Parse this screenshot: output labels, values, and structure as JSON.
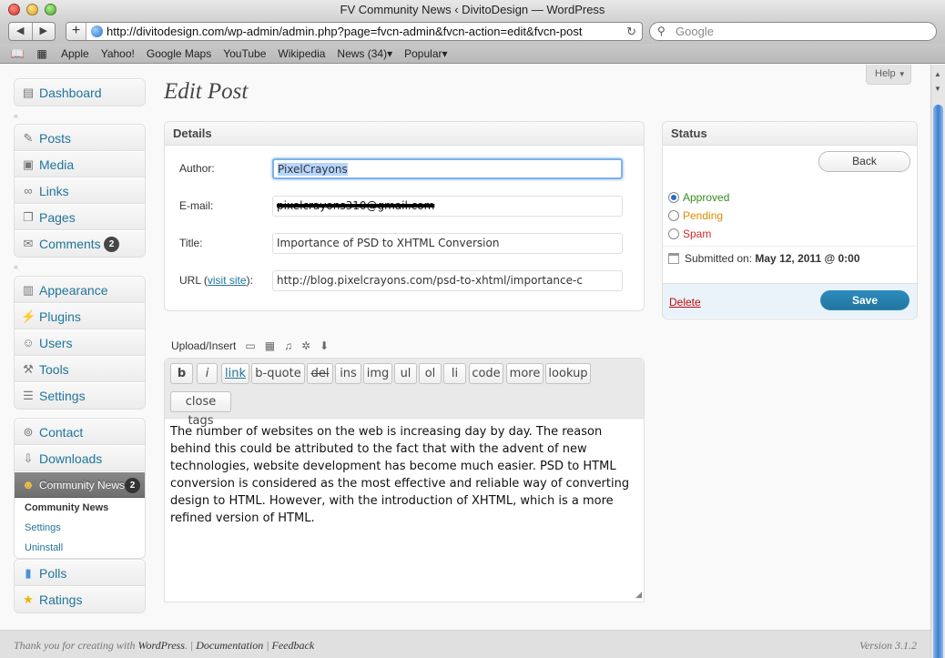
{
  "browser": {
    "window_title": "FV Community News ‹ DivitoDesign — WordPress",
    "url": "http://divitodesign.com/wp-admin/admin.php?page=fvcn-admin&fvcn-action=edit&fvcn-post",
    "search_placeholder": "Google",
    "back": "◀",
    "forward": "▶",
    "add": "+",
    "reload": "↻",
    "bookmarks": [
      "Apple",
      "Yahoo!",
      "Google Maps",
      "YouTube",
      "Wikipedia",
      "News (34)▾",
      "Popular▾"
    ]
  },
  "menu": {
    "dashboard": "Dashboard",
    "group1": [
      {
        "label": "Posts",
        "icon": "pin-icon"
      },
      {
        "label": "Media",
        "icon": "media-icon"
      },
      {
        "label": "Links",
        "icon": "link-icon"
      },
      {
        "label": "Pages",
        "icon": "pages-icon"
      },
      {
        "label": "Comments",
        "icon": "comments-icon",
        "badge": "2"
      }
    ],
    "group2": [
      {
        "label": "Appearance",
        "icon": "appearance-icon"
      },
      {
        "label": "Plugins",
        "icon": "plugins-icon"
      },
      {
        "label": "Users",
        "icon": "users-icon"
      },
      {
        "label": "Tools",
        "icon": "tools-icon"
      },
      {
        "label": "Settings",
        "icon": "settings-icon"
      }
    ],
    "group3": [
      {
        "label": "Contact",
        "icon": "contact-icon"
      },
      {
        "label": "Downloads",
        "icon": "downloads-icon"
      }
    ],
    "community": {
      "label": "Community News",
      "badge": "2"
    },
    "submenu": [
      "Community News",
      "Settings",
      "Uninstall"
    ],
    "group4": [
      {
        "label": "Polls",
        "icon": "polls-icon"
      },
      {
        "label": "Ratings",
        "icon": "star-icon"
      }
    ]
  },
  "header": {
    "help": "Help",
    "title": "Edit Post"
  },
  "details": {
    "heading": "Details",
    "author_label": "Author:",
    "author_value": "PixelCrayons",
    "email_label": "E-mail:",
    "email_value": "pixelcrayons310@gmail.com",
    "title_label": "Title:",
    "title_value": "Importance of PSD to XHTML Conversion",
    "url_label_prefix": "URL (",
    "url_label_link": "visit site",
    "url_label_suffix": "):",
    "url_value": "http://blog.pixelcrayons.com/psd-to-xhtml/importance-c"
  },
  "status": {
    "heading": "Status",
    "back": "Back",
    "approved": "Approved",
    "pending": "Pending",
    "spam": "Spam",
    "approved_color": "#3a8a1e",
    "pending_color": "#e08a00",
    "spam_color": "#d22c2c",
    "submitted_label": "Submitted on:",
    "submitted_value": "May 12, 2011 @ 0:00",
    "delete": "Delete",
    "save": "Save"
  },
  "editor": {
    "upload_label": "Upload/Insert",
    "quicktags": [
      "b",
      "i",
      "link",
      "b-quote",
      "del",
      "ins",
      "img",
      "ul",
      "ol",
      "li",
      "code",
      "more",
      "lookup",
      "close tags"
    ],
    "content": "The number of websites on the web is increasing day by day. The reason behind this could be attributed to the fact that with the advent of new technologies, website development has become much easier. PSD to HTML conversion is considered as the most effective and reliable way of converting design to HTML. However, with the introduction of XHTML, which is a more refined version of HTML."
  },
  "footer": {
    "thanks": "Thank you for creating with",
    "wordpress": "WordPress",
    "sep": ". |",
    "documentation": "Documentation",
    "sep2": "|",
    "feedback": "Feedback",
    "version": "Version 3.1.2"
  }
}
